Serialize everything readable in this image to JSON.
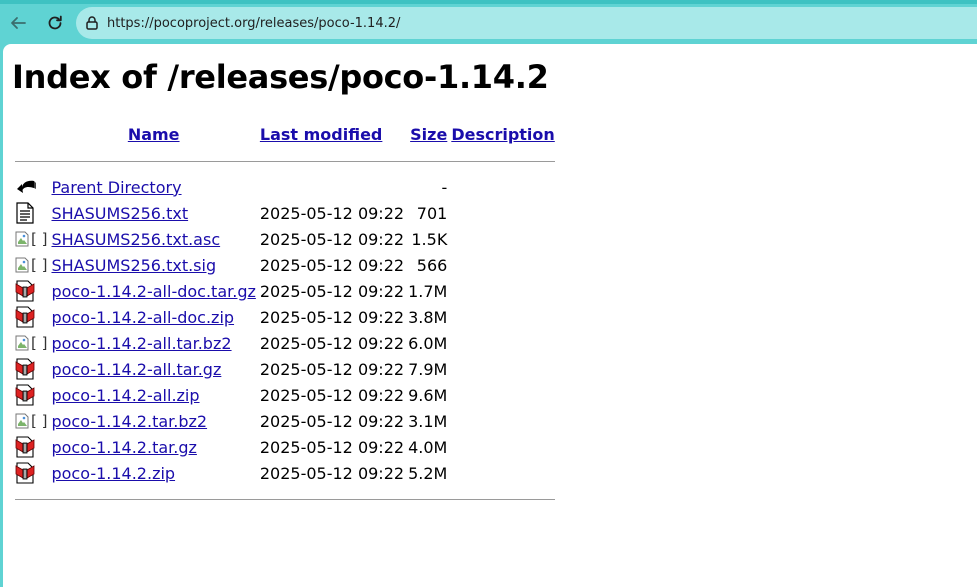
{
  "browser": {
    "url": "https://pocoproject.org/releases/poco-1.14.2/"
  },
  "page": {
    "title": "Index of /releases/poco-1.14.2",
    "headers": {
      "name": "Name",
      "last_modified": "Last modified",
      "size": "Size",
      "description": "Description"
    },
    "entries": [
      {
        "icon": "back-icon",
        "name": "Parent Directory",
        "modified": "",
        "size": "-",
        "description": ""
      },
      {
        "icon": "text-file-icon",
        "name": "SHASUMS256.txt",
        "modified": "2025-05-12 09:22",
        "size": "701",
        "description": ""
      },
      {
        "icon": "broken-image-icon",
        "alt": "[ ]",
        "name": "SHASUMS256.txt.asc",
        "modified": "2025-05-12 09:22",
        "size": "1.5K",
        "description": ""
      },
      {
        "icon": "broken-image-icon",
        "alt": "[ ]",
        "name": "SHASUMS256.txt.sig",
        "modified": "2025-05-12 09:22",
        "size": "566",
        "description": ""
      },
      {
        "icon": "compressed-file-icon",
        "name": "poco-1.14.2-all-doc.tar.gz",
        "modified": "2025-05-12 09:22",
        "size": "1.7M",
        "description": ""
      },
      {
        "icon": "compressed-file-icon",
        "name": "poco-1.14.2-all-doc.zip",
        "modified": "2025-05-12 09:22",
        "size": "3.8M",
        "description": ""
      },
      {
        "icon": "broken-image-icon",
        "alt": "[ ]",
        "name": "poco-1.14.2-all.tar.bz2",
        "modified": "2025-05-12 09:22",
        "size": "6.0M",
        "description": ""
      },
      {
        "icon": "compressed-file-icon",
        "name": "poco-1.14.2-all.tar.gz",
        "modified": "2025-05-12 09:22",
        "size": "7.9M",
        "description": ""
      },
      {
        "icon": "compressed-file-icon",
        "name": "poco-1.14.2-all.zip",
        "modified": "2025-05-12 09:22",
        "size": "9.6M",
        "description": ""
      },
      {
        "icon": "broken-image-icon",
        "alt": "[ ]",
        "name": "poco-1.14.2.tar.bz2",
        "modified": "2025-05-12 09:22",
        "size": "3.1M",
        "description": ""
      },
      {
        "icon": "compressed-file-icon",
        "name": "poco-1.14.2.tar.gz",
        "modified": "2025-05-12 09:22",
        "size": "4.0M",
        "description": ""
      },
      {
        "icon": "compressed-file-icon",
        "name": "poco-1.14.2.zip",
        "modified": "2025-05-12 09:22",
        "size": "5.2M",
        "description": ""
      }
    ]
  },
  "colors": {
    "toolbar": "#5fd3d3",
    "addressbar": "#a8e9e9",
    "link": "#1a0dab"
  }
}
